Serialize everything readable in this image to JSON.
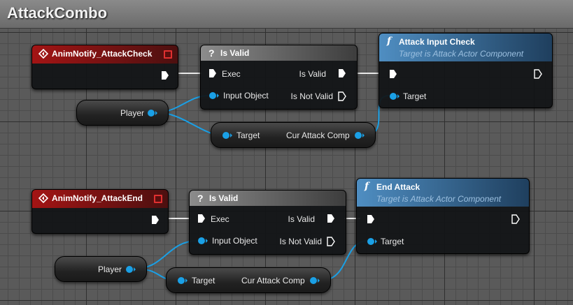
{
  "graph": {
    "title": "AttackCombo"
  },
  "colors": {
    "event_header": "#a31414",
    "function_header": "#4f8ec2",
    "object_pin": "#1aa0e6",
    "exec_pin": "#ffffff"
  },
  "row1": {
    "event": {
      "title": "AnimNotify_AttackCheck"
    },
    "branch": {
      "title": "Is Valid",
      "exec_in": "Exec",
      "is_valid": "Is Valid",
      "input_object": "Input Object",
      "is_not_valid": "Is Not Valid"
    },
    "player": {
      "label": "Player"
    },
    "getter": {
      "target": "Target",
      "output": "Cur Attack Comp"
    },
    "func": {
      "title": "Attack Input Check",
      "subtitle": "Target is Attack Actor Component",
      "target": "Target"
    }
  },
  "row2": {
    "event": {
      "title": "AnimNotify_AttackEnd"
    },
    "branch": {
      "title": "Is Valid",
      "exec_in": "Exec",
      "is_valid": "Is Valid",
      "input_object": "Input Object",
      "is_not_valid": "Is Not Valid"
    },
    "player": {
      "label": "Player"
    },
    "getter": {
      "target": "Target",
      "output": "Cur Attack Comp"
    },
    "func": {
      "title": "End Attack",
      "subtitle": "Target is Attack Actor Component",
      "target": "Target"
    }
  }
}
